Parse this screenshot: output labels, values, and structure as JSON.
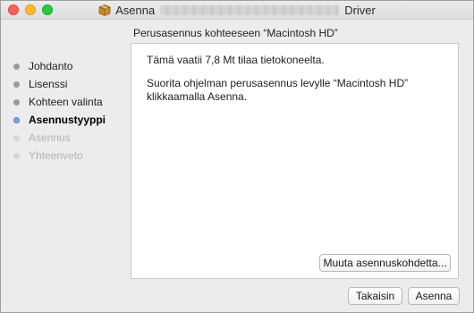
{
  "window": {
    "title_prefix": "Asenna",
    "title_suffix": "Driver"
  },
  "header": {
    "text": "Perusasennus kohteeseen “Macintosh HD”"
  },
  "sidebar": {
    "steps": [
      {
        "label": "Johdanto",
        "state": "done"
      },
      {
        "label": "Lisenssi",
        "state": "done"
      },
      {
        "label": "Kohteen valinta",
        "state": "done"
      },
      {
        "label": "Asennustyyppi",
        "state": "current"
      },
      {
        "label": "Asennus",
        "state": "future"
      },
      {
        "label": "Yhteenveto",
        "state": "future"
      }
    ]
  },
  "content": {
    "space_text": "Tämä vaatii 7,8 Mt tilaa tietokoneelta.",
    "instruction_text": "Suorita ohjelman perusasennus levylle “Macintosh HD” klikkaamalla Asenna.",
    "change_location_label": "Muuta asennuskohdetta..."
  },
  "footer": {
    "back_label": "Takaisin",
    "install_label": "Asenna"
  },
  "colors": {
    "close": "#fc5f57",
    "minimize": "#fdbc2e",
    "maximize": "#28c840",
    "current_step_dot": "#7aa3d6"
  }
}
